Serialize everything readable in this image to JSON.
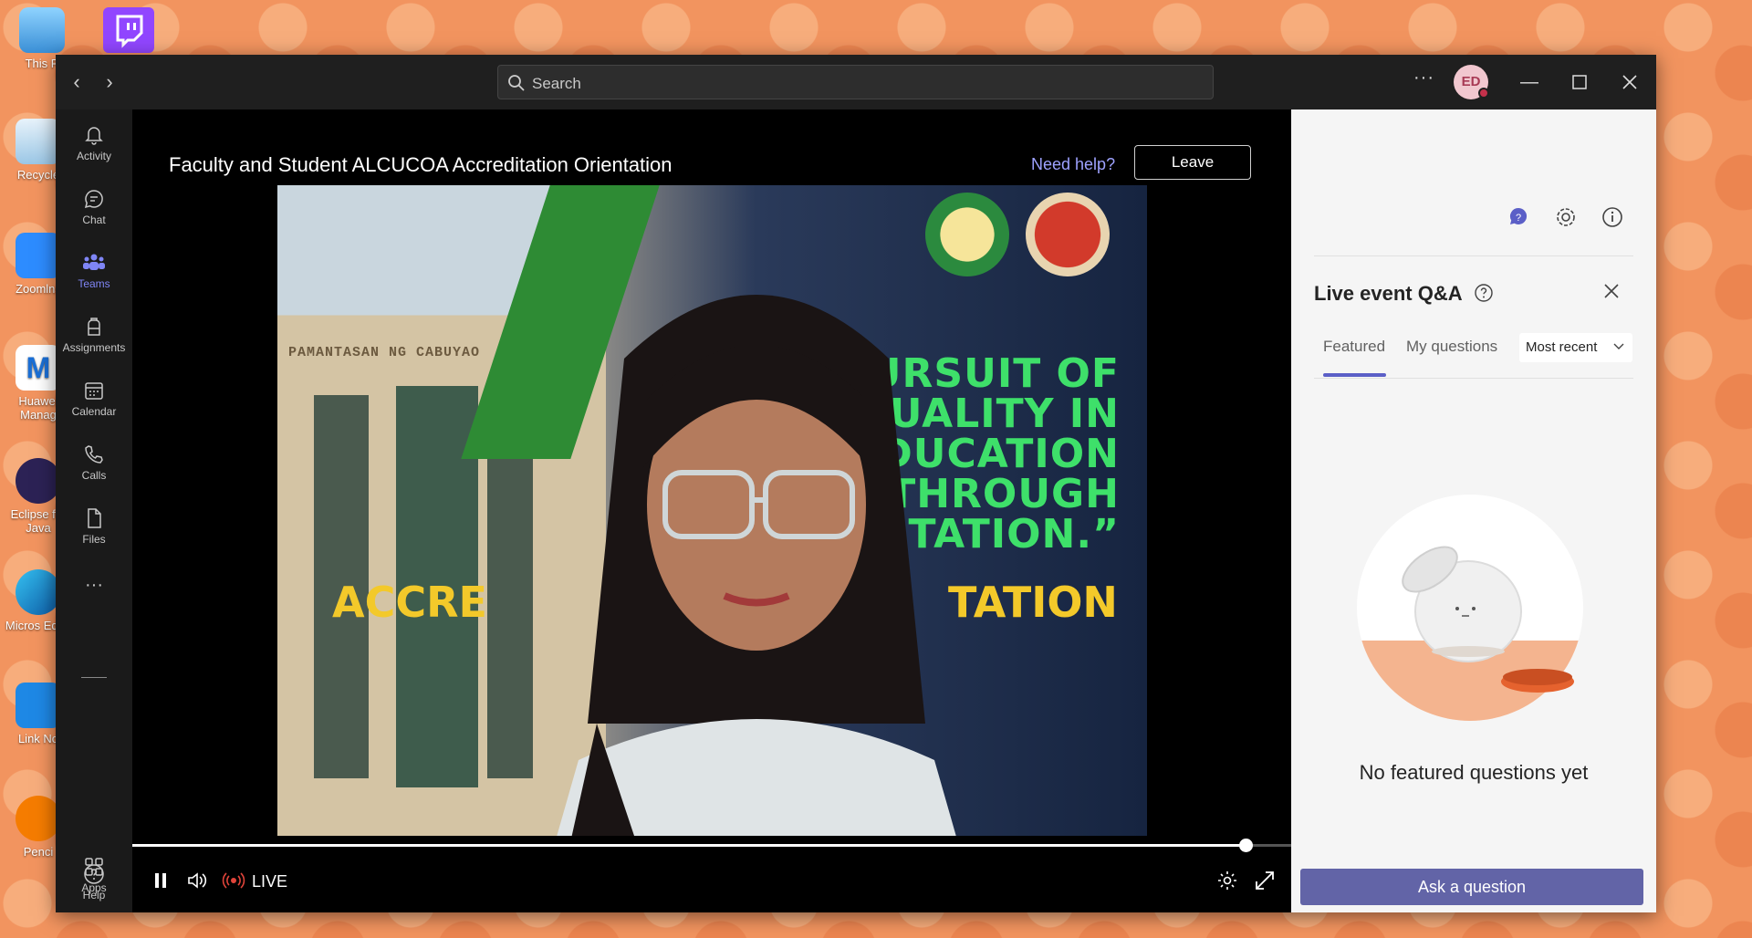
{
  "desktop": {
    "icons": [
      {
        "label": "This P",
        "name": "this-pc"
      },
      {
        "label": "Recycle",
        "name": "recycle-bin"
      },
      {
        "label": "Zoomlns",
        "name": "zoom"
      },
      {
        "label": "Huawei Manag",
        "name": "huawei-manager"
      },
      {
        "label": "Eclipse for Java",
        "name": "eclipse"
      },
      {
        "label": "Micros Edge",
        "name": "edge"
      },
      {
        "label": "Link No",
        "name": "link-notes"
      },
      {
        "label": "Penci",
        "name": "pencil"
      }
    ]
  },
  "titlebar": {
    "search_placeholder": "Search",
    "avatar_initials": "ED"
  },
  "rail": {
    "items": [
      {
        "label": "Activity",
        "icon": "bell-icon"
      },
      {
        "label": "Chat",
        "icon": "chat-icon"
      },
      {
        "label": "Teams",
        "icon": "teams-icon",
        "active": true
      },
      {
        "label": "Assignments",
        "icon": "backpack-icon"
      },
      {
        "label": "Calendar",
        "icon": "calendar-icon"
      },
      {
        "label": "Calls",
        "icon": "phone-icon"
      },
      {
        "label": "Files",
        "icon": "file-icon"
      }
    ],
    "more": "···",
    "apps_label": "Apps",
    "help_label": "Help"
  },
  "stage": {
    "meeting_title": "Faculty and Student ALCUCOA Accreditation Orientation",
    "help_link": "Need help?",
    "leave_label": "Leave",
    "video": {
      "building_sign": "PAMANTASAN NG CABUYAO",
      "slogan_lines": [
        "URSUIT OF",
        "QUALITY IN",
        "DUCATION",
        "THROUGH",
        "TATION.”"
      ],
      "banner_left": "ACCRE",
      "banner_right": "TATION"
    },
    "controls": {
      "live_label": "LIVE",
      "progress": 0.99
    }
  },
  "qa": {
    "title": "Live event Q&A",
    "tabs": [
      {
        "label": "Featured",
        "active": true
      },
      {
        "label": "My questions",
        "active": false
      }
    ],
    "sort_value": "Most recent",
    "empty_text": "No featured questions yet",
    "ask_button": "Ask a question"
  },
  "colors": {
    "accent": "#5b5fc7",
    "rail_active": "#7f85f5",
    "ask_button": "#6264a7",
    "help_link": "#9ea2ff",
    "wallpaper": "#f2945f"
  }
}
